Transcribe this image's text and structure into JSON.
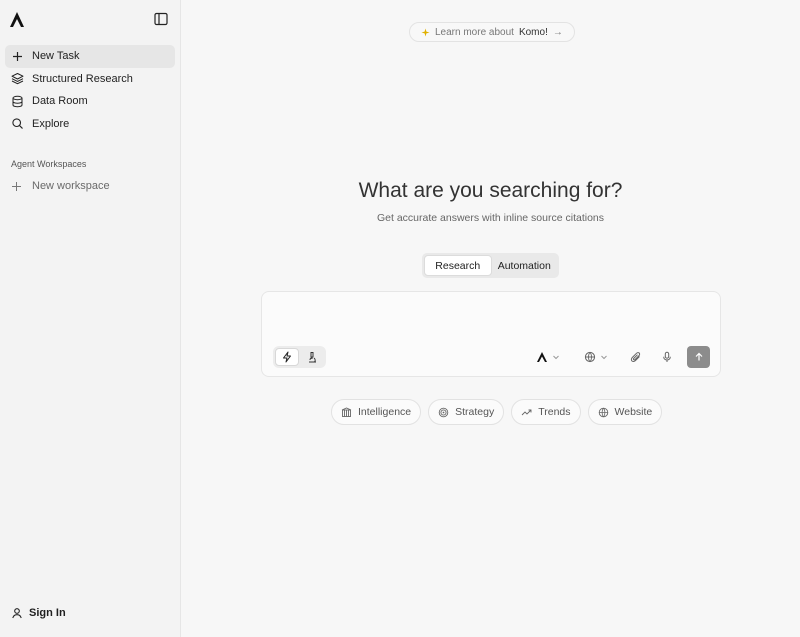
{
  "sidebar": {
    "logo_icon": "komo-logo-icon",
    "toggle_icon": "sidebar-toggle-icon",
    "nav": [
      {
        "label": "New Task",
        "icon": "plus-icon"
      },
      {
        "label": "Structured Research",
        "icon": "layers-icon"
      },
      {
        "label": "Data Room",
        "icon": "database-icon"
      },
      {
        "label": "Explore",
        "icon": "search-icon"
      }
    ],
    "section_title": "Agent Workspaces",
    "new_workspace": "New workspace",
    "sign_in": "Sign In"
  },
  "main": {
    "learn_prefix": "Learn more about",
    "learn_brand": "Komo!",
    "learn_arrow": "→",
    "headline": "What are you searching for?",
    "subline": "Get accurate answers with inline source citations",
    "modes": [
      "Research",
      "Automation"
    ],
    "active_mode": "Research",
    "search_placeholder": "",
    "chips": [
      {
        "label": "Intelligence",
        "icon": "building-icon"
      },
      {
        "label": "Strategy",
        "icon": "target-icon"
      },
      {
        "label": "Trends",
        "icon": "trending-up-icon"
      },
      {
        "label": "Website",
        "icon": "globe-icon"
      }
    ]
  },
  "colors": {
    "background": "#f7f7f7",
    "sidebar": "#f3f3f3",
    "send_button": "#8c8c8c",
    "sparkle": "#e0b000"
  }
}
